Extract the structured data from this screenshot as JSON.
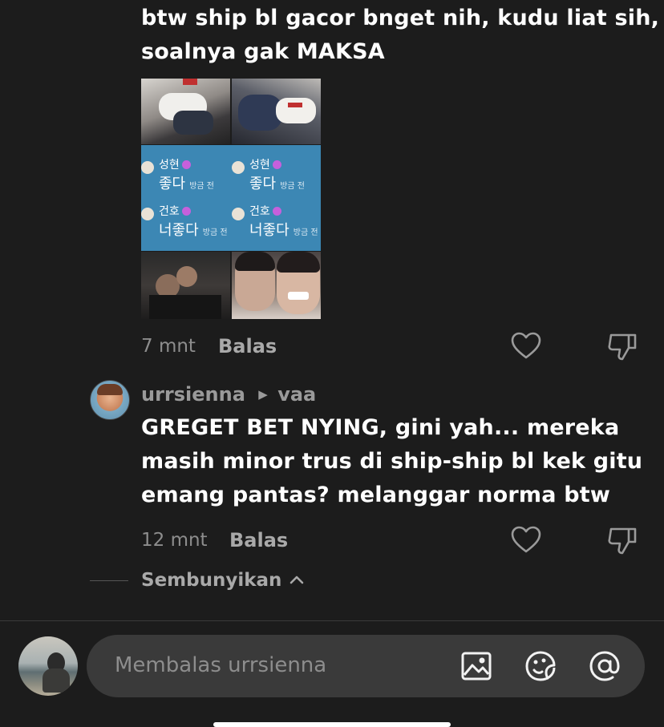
{
  "comment1": {
    "text_line1": "btw ship bl gacor bnget nih, kudu liat sih,",
    "text_line2": "soalnya gak MAKSA",
    "collage": {
      "rows": [
        {
          "name": "성현",
          "text": "좋다",
          "time": "방금 전"
        },
        {
          "name": "건호",
          "text": "너좋다",
          "time": "방금 전"
        }
      ]
    },
    "time": "7 mnt",
    "reply_label": "Balas"
  },
  "comment2": {
    "username": "urrsienna",
    "reply_to": "vaa",
    "text_line1": "GREGET BET NYING, gini yah... mereka",
    "text_line2": "masih minor trus di ship-ship bl kek gitu",
    "text_line3": "emang pantas? melanggar norma btw",
    "time": "12 mnt",
    "reply_label": "Balas"
  },
  "hide_replies": {
    "label": "Sembunyikan"
  },
  "composer": {
    "placeholder": "Membalas urrsienna",
    "icons": [
      "image-icon",
      "sticker-icon",
      "mention-icon"
    ]
  },
  "colors": {
    "background": "#1c1c1c",
    "input_bg": "#3a3a3a",
    "muted": "#8d8d8d"
  }
}
